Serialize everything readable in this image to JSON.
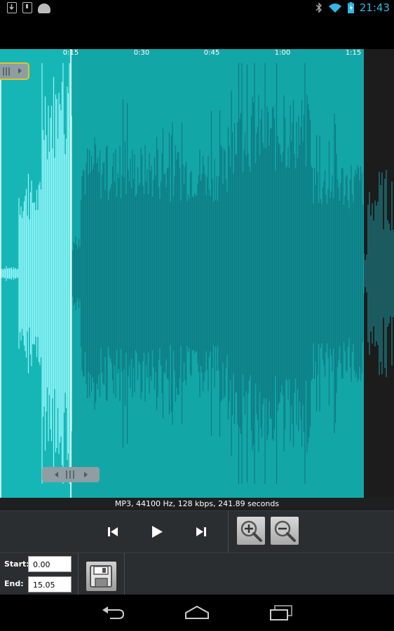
{
  "status_bar": {
    "time": "21:43",
    "left_icons": [
      "download-icon",
      "sd-card-icon",
      "android-icon"
    ],
    "right_icons": [
      "bluetooth-icon",
      "wifi-icon",
      "battery-icon"
    ],
    "accent": "#33b5e5"
  },
  "timeline": {
    "ticks": [
      {
        "label": "0:15"
      },
      {
        "label": "0:30"
      },
      {
        "label": "0:45"
      },
      {
        "label": "1:00"
      },
      {
        "label": "1:15"
      }
    ]
  },
  "colors": {
    "wave_bg": "#13a6a6",
    "wave_dark": "#0e7a84",
    "selection_bg": "#17b6b6",
    "selection_wave": "#8ff6fa",
    "handle_border": "#e6c22c"
  },
  "file_info": "MP3, 44100 Hz, 128 kbps, 241.89 seconds",
  "controls": {
    "prev_icon": "skip-previous-icon",
    "play_icon": "play-icon",
    "next_icon": "skip-next-icon",
    "zoom_in_icon": "zoom-in-icon",
    "zoom_out_icon": "zoom-out-icon"
  },
  "range": {
    "start_label": "Start:",
    "start_value": "0.00",
    "end_label": "End:",
    "end_value": "15.05",
    "save_icon": "save-icon"
  },
  "nav": [
    "back-icon",
    "home-icon",
    "recent-apps-icon"
  ]
}
